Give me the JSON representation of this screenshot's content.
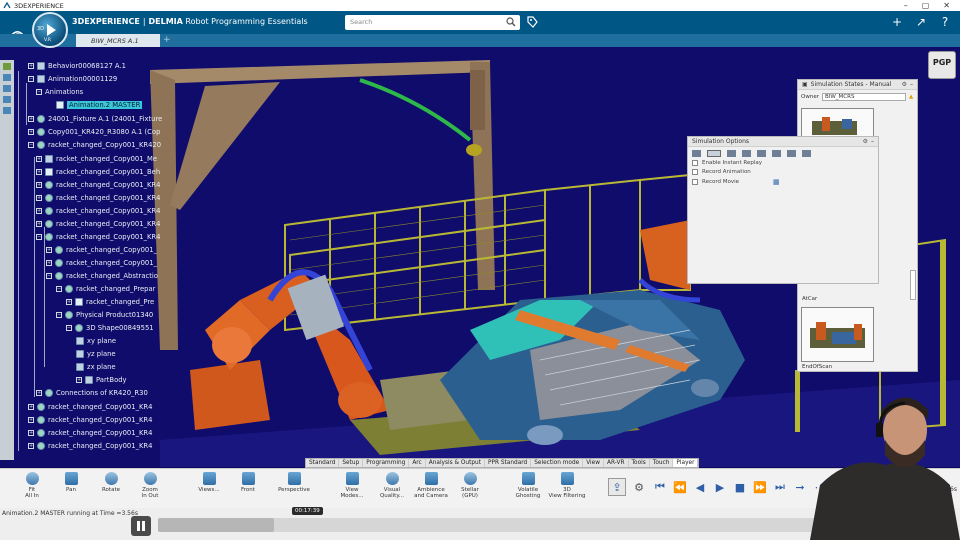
{
  "window": {
    "title": "3DEXPERIENCE"
  },
  "header": {
    "brand_bold": "3DEXPERIENCE",
    "brand_sep": "|",
    "brand_app": "DELMIA",
    "brand_product": "Robot Programming Essentials",
    "search_placeholder": "Search",
    "compass_version": "V.R",
    "compass_label": "3D"
  },
  "tabs": [
    {
      "label": "BIW_MCRS A.1"
    }
  ],
  "tree": {
    "items": [
      {
        "label": "Behavior00068127 A.1"
      },
      {
        "label": "Animation00001129"
      },
      {
        "label": "Animations"
      },
      {
        "label": "Animation.2 MASTER"
      },
      {
        "label": "24001_Fixture A.1 (24001_Fixture"
      },
      {
        "label": "Copy001_KR420_R3080 A.1 (Cop"
      },
      {
        "label": "racket_changed_Copy001_KR420"
      },
      {
        "label": "racket_changed_Copy001_Me"
      },
      {
        "label": "racket_changed_Copy001_Beh"
      },
      {
        "label": "racket_changed_Copy001_KR4"
      },
      {
        "label": "racket_changed_Copy001_KR4"
      },
      {
        "label": "racket_changed_Copy001_KR4"
      },
      {
        "label": "racket_changed_Copy001_KR4"
      },
      {
        "label": "racket_changed_Copy001_KR4"
      },
      {
        "label": "racket_changed_Copy001_"
      },
      {
        "label": "racket_changed_Copy001_"
      },
      {
        "label": "racket_changed_Abstractio"
      },
      {
        "label": "racket_changed_Prepar"
      },
      {
        "label": "racket_changed_Pre"
      },
      {
        "label": "Physical Product01340"
      },
      {
        "label": "3D Shape00849551"
      },
      {
        "label": "xy plane"
      },
      {
        "label": "yz plane"
      },
      {
        "label": "zx plane"
      },
      {
        "label": "PartBody"
      },
      {
        "label": "Connections of KR420_R30"
      },
      {
        "label": "racket_changed_Copy001_KR4"
      },
      {
        "label": "racket_changed_Copy001_KR4"
      },
      {
        "label": "racket_changed_Copy001_KR4"
      },
      {
        "label": "racket_changed_Copy001_KR4"
      },
      {
        "label": "racket_changed_Copy001_KR4"
      }
    ]
  },
  "sim_states": {
    "title": "Simulation States - Manual",
    "owner_label": "Owner",
    "owner_value": "BIW_MCRS",
    "captions": [
      "AtCar",
      "EndOfScan"
    ]
  },
  "sim_options": {
    "title": "Simulation Options",
    "options": [
      "Enable Instant Replay",
      "Record Animation",
      "Record Movie"
    ]
  },
  "badge": {
    "label": "PGP"
  },
  "section_tabs": [
    "Standard",
    "Setup",
    "Programming",
    "Arc",
    "Analysis & Output",
    "PPR Standard",
    "Selection mode",
    "View",
    "AR-VR",
    "Tools",
    "Touch",
    "Player"
  ],
  "active_section": "Player",
  "tools": [
    {
      "label": "Fit\nAll In"
    },
    {
      "label": "Pan"
    },
    {
      "label": "Rotate"
    },
    {
      "label": "Zoom\nIn Out"
    },
    {
      "label": "Views..."
    },
    {
      "label": "Front"
    },
    {
      "label": "Perspective"
    },
    {
      "label": "View\nModes..."
    },
    {
      "label": "Visual\nQuality..."
    },
    {
      "label": "Ambience\nand Camera"
    },
    {
      "label": "Stellar\n(GPU)"
    },
    {
      "label": "Volatile\nGhosting"
    },
    {
      "label": "3D\nView Filtering"
    }
  ],
  "player": {
    "status": "Animation.2 MASTER running at Time =3.56s",
    "time": "00:17:39",
    "end_time": "3.56s",
    "progress": 0.147
  },
  "colors": {
    "header": "#005685",
    "viewport": "#100c6b",
    "accent": "#2f5fa8"
  }
}
